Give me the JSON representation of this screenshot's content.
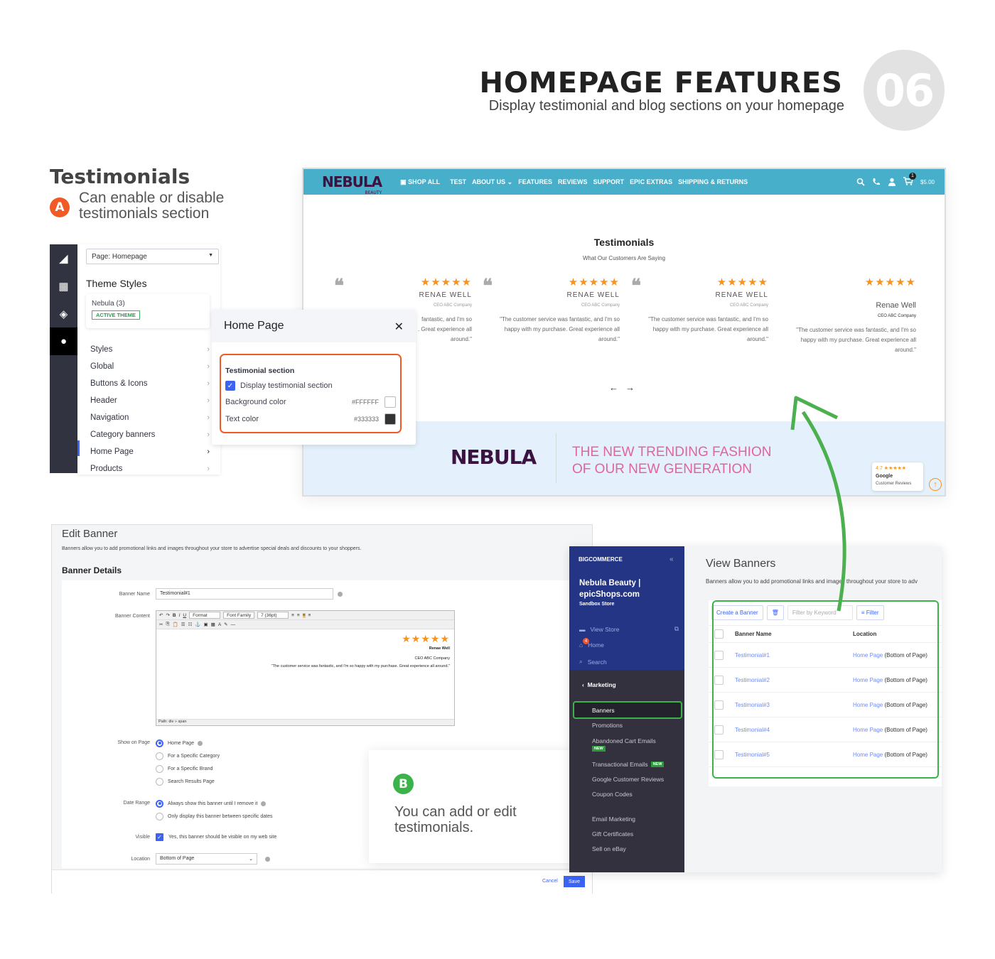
{
  "header": {
    "title": "HOMEPAGE FEATURES",
    "subtitle": "Display testimonial and blog sections on your homepage",
    "number": "06"
  },
  "section_a": {
    "heading": "Testimonials",
    "badge": "A",
    "description_line1": "Can enable or disable",
    "description_line2": "testimonials section"
  },
  "store": {
    "logo": "NEBULA",
    "logo_sub": "BEAUTY",
    "nav": [
      "SHOP ALL",
      "TEST",
      "ABOUT US ⌄",
      "FEATURES",
      "REVIEWS",
      "SUPPORT",
      "EPIC EXTRAS",
      "SHIPPING & RETURNS"
    ],
    "cart_count": "1",
    "cart_total": "$5.00",
    "testimonials_title": "Testimonials",
    "testimonials_subtitle": "What Our Customers Are Saying",
    "cards": [
      {
        "stars": "★★★★★",
        "name": "RENAE WELL",
        "company": "CEO ABC Company",
        "quote_l1": "fantastic, and I'm so",
        "quote_l2": ". Great experience all",
        "quote_l3": "around.\""
      },
      {
        "stars": "★★★★★",
        "name": "RENAE WELL",
        "company": "CEO ABC Company",
        "quote_l1": "\"The customer service was fantastic, and I'm so",
        "quote_l2": "happy with my purchase. Great experience all",
        "quote_l3": "around.\""
      },
      {
        "stars": "★★★★★",
        "name": "RENAE WELL",
        "company": "CEO ABC Company",
        "quote_l1": "\"The customer service was fantastic, and I'm so",
        "quote_l2": "happy with my purchase. Great experience all",
        "quote_l3": "around.\""
      },
      {
        "stars": "★★★★★",
        "name": "Renae Well",
        "company": "CEO ABC Company",
        "quote_l1": "\"The customer service was fantastic, and I'm so",
        "quote_l2": "happy with my purchase. Great experience all",
        "quote_l3": "around.\""
      }
    ],
    "prev": "←",
    "next": "→",
    "promo_line1": "THE NEW TRENDING FASHION",
    "promo_line2": "OF OUR NEW GENERATION",
    "google_rating": "4.7 ★★★★★",
    "google_label": "Google",
    "google_sub": "Customer Reviews"
  },
  "theme_editor": {
    "page_select": "Page: Homepage",
    "heading": "Theme Styles",
    "theme_name": "Nebula (3)",
    "active_badge": "ACTIVE THEME",
    "menu": [
      "Styles",
      "Global",
      "Buttons & Icons",
      "Header",
      "Navigation",
      "Category banners",
      "Home Page",
      "Products"
    ],
    "panel_title": "Home Page",
    "section_label": "Testimonial section",
    "checkbox_label": "Display testimonial section",
    "bg_label": "Background color",
    "bg_value": "#FFFFFF",
    "text_label": "Text color",
    "text_value": "#333333"
  },
  "edit_banner": {
    "title": "Edit Banner",
    "description": "Banners allow you to add promotional links and images throughout your store to advertise special deals and discounts to your shoppers.",
    "details_heading": "Banner Details",
    "name_label": "Banner Name",
    "name_value": "Testimonial#1",
    "content_label": "Banner Content",
    "toolbar_format": "Format",
    "toolbar_font": "Font Family",
    "toolbar_size": "7 (36pt)",
    "content_stars": "★★★★★",
    "content_name": "Renae Well",
    "content_company": "CEO ABC Company",
    "content_quote": "\"The customer service was fantastic, and I'm so happy with my purchase. Great experience all around.\"",
    "path": "Path: div » span",
    "show_label": "Show on Page",
    "show_options": [
      "Home Page",
      "For a Specific Category",
      "For a Specific Brand",
      "Search Results Page"
    ],
    "date_label": "Date Range",
    "date_options": [
      "Always show this banner until I remove it",
      "Only display this banner between specific dates"
    ],
    "visible_label": "Visible",
    "visible_text": "Yes, this banner should be visible on my web site",
    "location_label": "Location",
    "location_value": "Bottom of Page",
    "cancel": "Cancel",
    "save": "Save"
  },
  "section_b": {
    "badge": "B",
    "line1": "You can add or edit",
    "line2": "testimonials."
  },
  "bigcommerce": {
    "logo": "BIGCOMMERCE",
    "collapse": "«",
    "store_l1": "Nebula Beauty |",
    "store_l2": "epicShops.com",
    "store_type": "Sandbox Store",
    "links": [
      "View Store",
      "Home",
      "Search"
    ],
    "home_badge": "4",
    "section": "Marketing",
    "items": [
      "Banners",
      "Promotions",
      "Abandoned Cart Emails",
      "Transactional Emails",
      "Google Customer Reviews",
      "Coupon Codes",
      "Email Marketing",
      "Gift Certificates",
      "Sell on eBay"
    ],
    "new_badge": "NEW",
    "page_title": "View Banners",
    "page_desc": "Banners allow you to add promotional links and images throughout your store to adv",
    "create_btn": "Create a Banner",
    "filter_placeholder": "Filter by Keyword",
    "filter_btn": "Filter",
    "col_name": "Banner Name",
    "col_location": "Location",
    "rows": [
      {
        "name": "Testimonial#1",
        "loc_link": "Home Page",
        "loc_text": "(Bottom of Page)"
      },
      {
        "name": "Testimonial#2",
        "loc_link": "Home Page",
        "loc_text": "(Bottom of Page)"
      },
      {
        "name": "Testimonial#3",
        "loc_link": "Home Page",
        "loc_text": "(Bottom of Page)"
      },
      {
        "name": "Testimonial#4",
        "loc_link": "Home Page",
        "loc_text": "(Bottom of Page)"
      },
      {
        "name": "Testimonial#5",
        "loc_link": "Home Page",
        "loc_text": "(Bottom of Page)"
      }
    ]
  },
  "colors": {
    "accent_orange": "#f15a24",
    "accent_green": "#3cb34a",
    "nav_teal": "#47afc9",
    "star": "#f7931e",
    "bc_blue": "#233584",
    "primary": "#3c64f4"
  }
}
